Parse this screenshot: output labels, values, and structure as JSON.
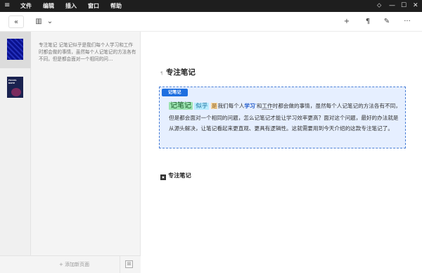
{
  "titlebar": {
    "menu_icon": "≡",
    "menus": [
      "文件",
      "编辑",
      "插入",
      "窗口",
      "帮助"
    ],
    "pin_icon": "⬦",
    "minimize_icon": "—",
    "maximize_icon": "☐",
    "close_icon": "✕"
  },
  "toolbar": {
    "collapse_icon": "«",
    "view_icon": "▥",
    "dropdown_icon": "⌄",
    "add_icon": "+",
    "format_icon": "¶",
    "magic_icon": "✎",
    "more_icon": "···"
  },
  "sidebar": {
    "thumb2_text": "FOCUS NOTE",
    "preview_text": "专注笔记 记笔记似乎是我们每个人学习和工作时都会做的事情，虽然每个人记笔记的方法各有不同，但是都会面对一个相同的问…",
    "add_page": "+ 添加新页面",
    "grid_icon": "⊞"
  },
  "main": {
    "title_mark": "¶",
    "title": "专注笔记",
    "note": {
      "tag": "记笔记",
      "hl1": "记笔记",
      "hl2": "似乎",
      "hl3": "是",
      "t1": "我们每个人",
      "bold": "学习",
      "badge": "¹",
      "t2": "和",
      "ul": "工作",
      "t3": "时都会做的事情，虽然每个人记笔记的方法各有不同，但是都会面对一个相同的问题，怎么记笔记才能让学习效率更高？面对这个问题，最好的办法就是从源头解决，让笔记看起来更直观、更具有逻辑性。这就需要用到今天介绍的这款专注笔记了。"
    },
    "bottom_icon_text": "▣",
    "bottom_title": "专注笔记"
  },
  "colors": {
    "titlebar": "#1e1e1e",
    "accent": "#1e6fe0",
    "note_bg": "#e6efff"
  }
}
